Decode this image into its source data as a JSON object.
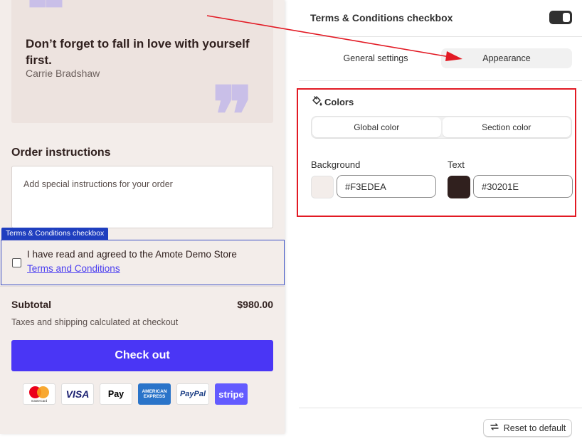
{
  "preview": {
    "quote": {
      "text": "Don’t forget to fall in love with yourself first.",
      "author": "Carrie Bradshaw",
      "open_mark": "❝",
      "close_mark": "❞"
    },
    "order_instructions": {
      "title": "Order instructions",
      "placeholder": "Add special instructions for your order"
    },
    "terms": {
      "tag": "Terms & Conditions checkbox",
      "text": "I have read and agreed to the Amote Demo Store",
      "link": "Terms and Conditions"
    },
    "subtotal_label": "Subtotal",
    "subtotal_value": "$980.00",
    "taxes_note": "Taxes and shipping calculated at checkout",
    "checkout_label": "Check out",
    "payment_methods": {
      "mastercard": "mastercard",
      "visa": "VISA",
      "applepay": " Pay",
      "amex_line1": "AMERICAN",
      "amex_line2": "EXPRESS",
      "paypal": "PayPal",
      "stripe": "stripe"
    },
    "colors": {
      "accent": "#4a36f5",
      "bg": "#f3edea",
      "text": "#30201e"
    }
  },
  "panel": {
    "title": "Terms & Conditions checkbox",
    "toggle_on": true,
    "tabs": [
      "General settings",
      "Appearance"
    ],
    "active_tab": "Appearance",
    "colors_title": "Colors",
    "color_modes": [
      "Global color",
      "Section color"
    ],
    "background": {
      "label": "Background",
      "value": "#F3EDEA",
      "swatch": "#f3edea"
    },
    "text": {
      "label": "Text",
      "value": "#30201E",
      "swatch": "#30201e"
    },
    "reset_label": "Reset to default"
  },
  "annotations": {
    "highlight_color": "#e21a24"
  }
}
